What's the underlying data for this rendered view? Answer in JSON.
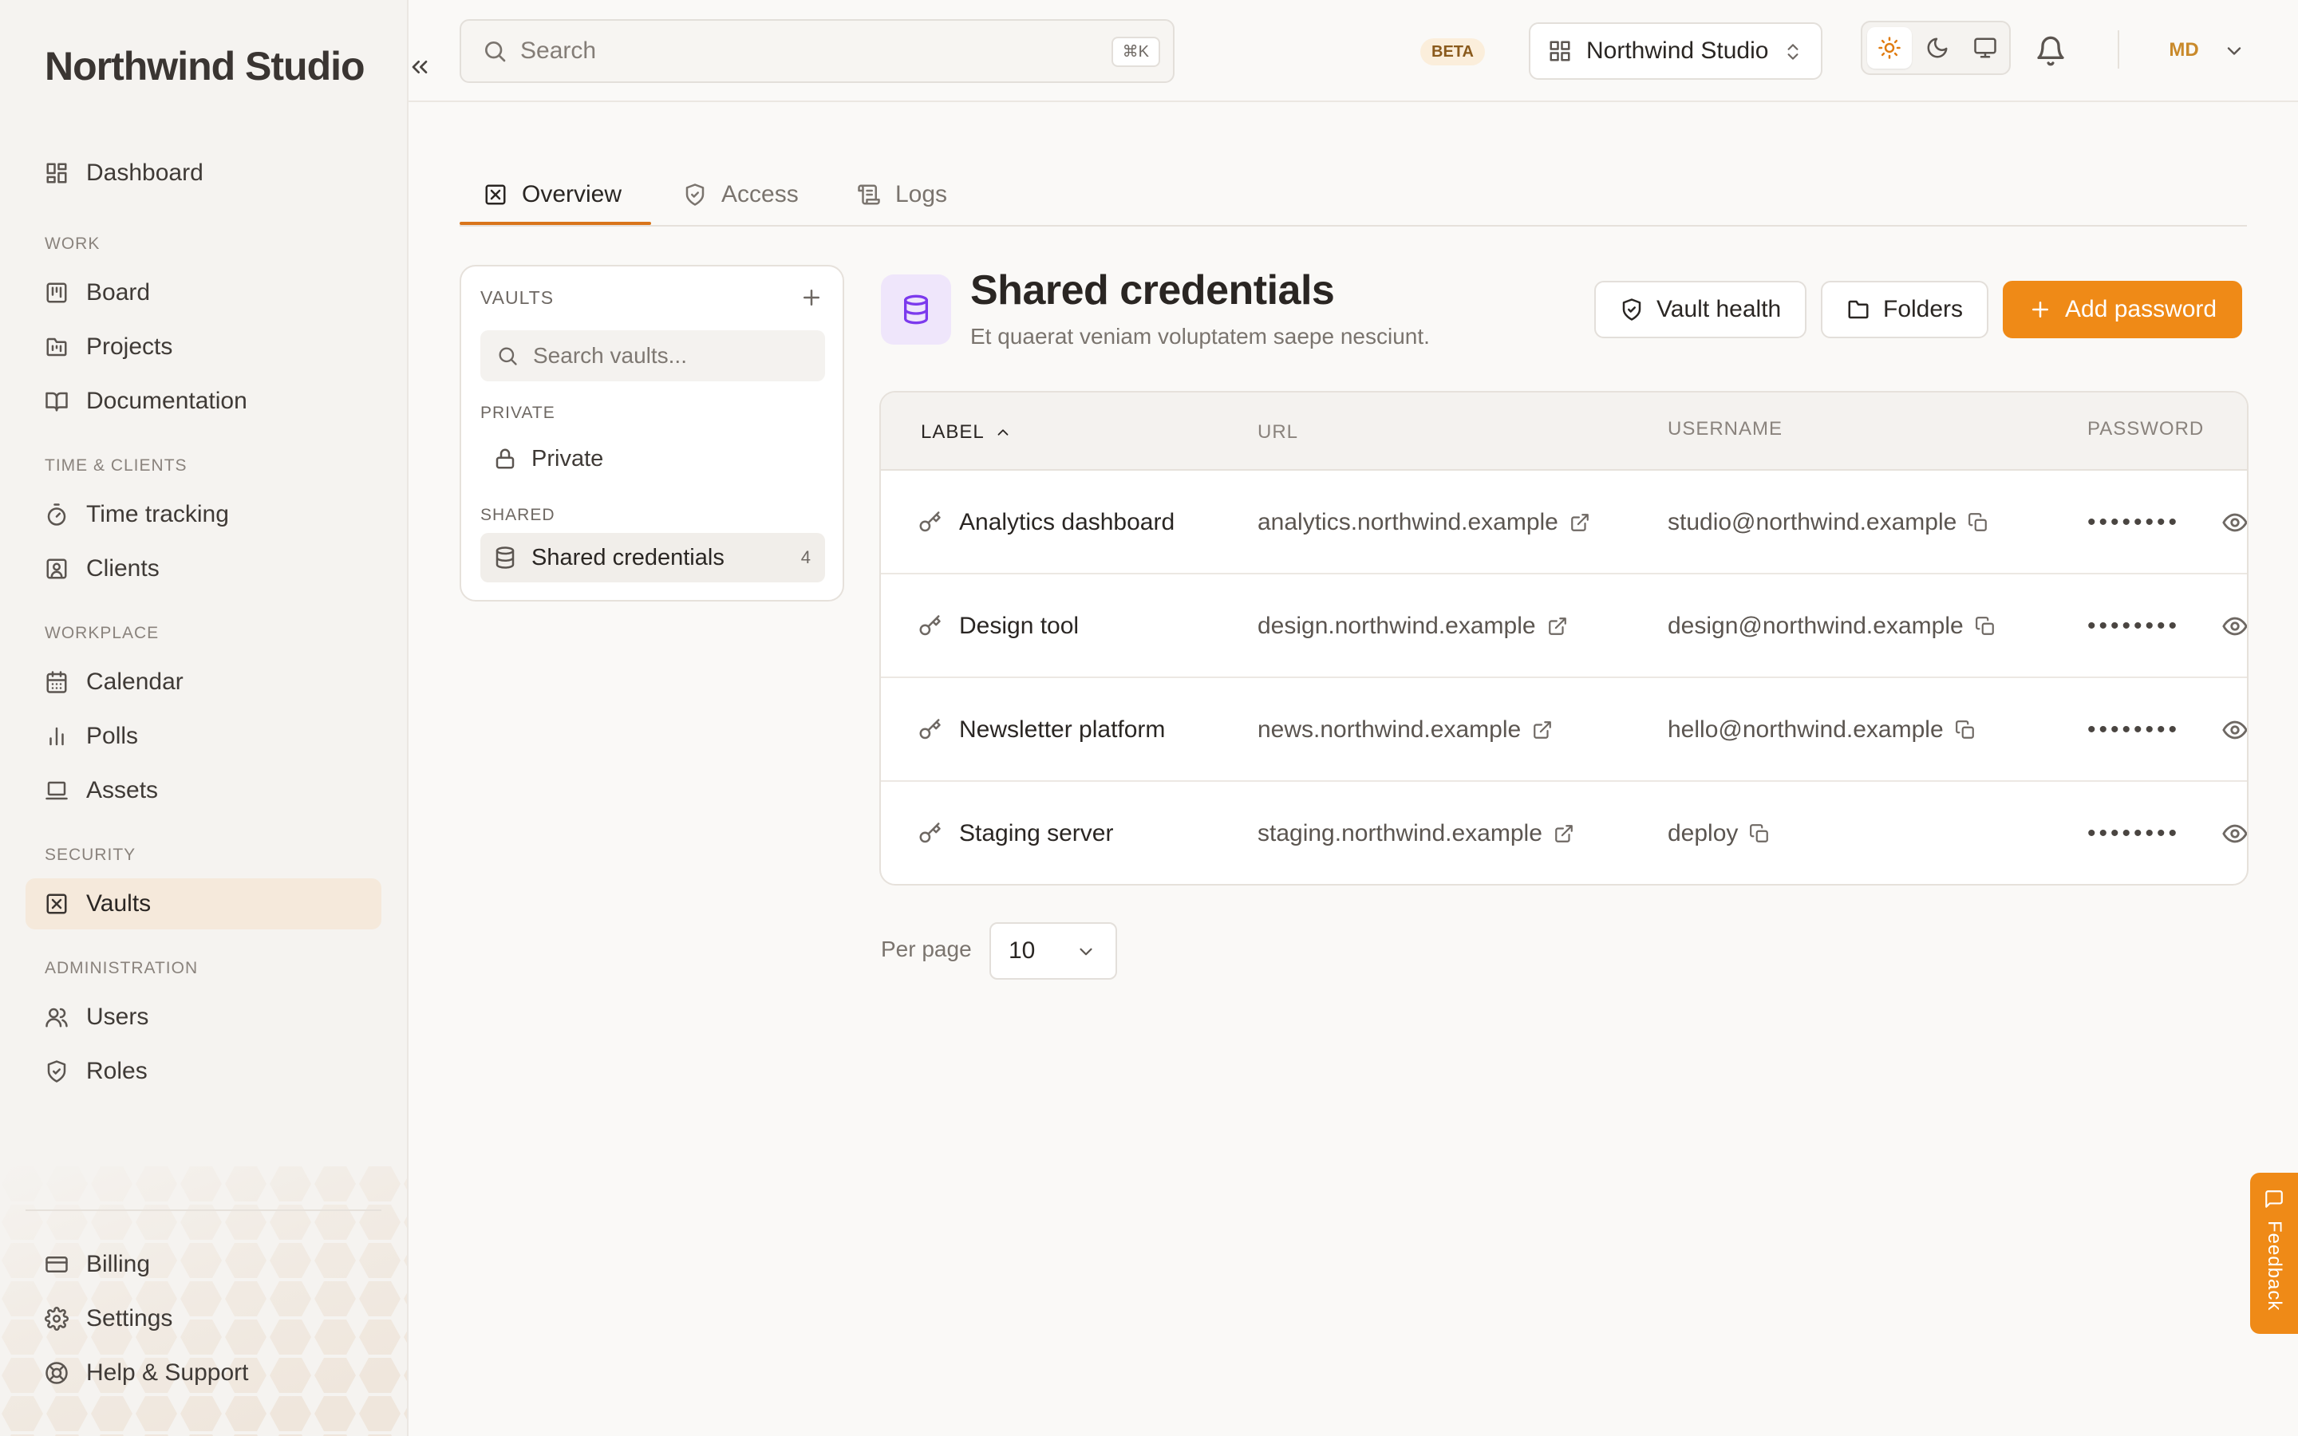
{
  "app": {
    "brand": "Northwind Studio"
  },
  "sidebar": {
    "dashboard": "Dashboard",
    "sections": {
      "work": "WORK",
      "time_clients": "TIME & CLIENTS",
      "workplace": "WORKPLACE",
      "security": "SECURITY",
      "administration": "ADMINISTRATION"
    },
    "items": {
      "board": "Board",
      "projects": "Projects",
      "documentation": "Documentation",
      "time_tracking": "Time tracking",
      "clients": "Clients",
      "calendar": "Calendar",
      "polls": "Polls",
      "assets": "Assets",
      "vaults": "Vaults",
      "users": "Users",
      "roles": "Roles",
      "billing": "Billing",
      "settings": "Settings",
      "help": "Help & Support"
    },
    "active_item": "Vaults"
  },
  "topbar": {
    "search_placeholder": "Search",
    "search_shortcut": "⌘K",
    "beta": "BETA",
    "org_name": "Northwind Studio",
    "theme_selected": "light",
    "avatar_initials": "MD"
  },
  "tabs": {
    "overview": "Overview",
    "access": "Access",
    "logs": "Logs",
    "active": "Overview"
  },
  "vaults_panel": {
    "heading": "VAULTS",
    "search_placeholder": "Search vaults...",
    "private_heading": "PRIVATE",
    "private_item": "Private",
    "shared_heading": "SHARED",
    "shared_item": "Shared credentials",
    "shared_count": "4"
  },
  "header": {
    "title": "Shared credentials",
    "subtitle": "Et quaerat veniam voluptatem saepe nesciunt.",
    "vault_health": "Vault health",
    "folders": "Folders",
    "add_password": "Add password"
  },
  "table": {
    "columns": {
      "label": "LABEL",
      "url": "URL",
      "username": "USERNAME",
      "password": "PASSWORD"
    },
    "rows": [
      {
        "label": "Analytics dashboard",
        "url": "analytics.northwind.example",
        "username": "studio@northwind.example",
        "password": "••••••••"
      },
      {
        "label": "Design tool",
        "url": "design.northwind.example",
        "username": "design@northwind.example",
        "password": "••••••••"
      },
      {
        "label": "Newsletter platform",
        "url": "news.northwind.example",
        "username": "hello@northwind.example",
        "password": "••••••••"
      },
      {
        "label": "Staging server",
        "url": "staging.northwind.example",
        "username": "deploy",
        "password": "••••••••"
      }
    ]
  },
  "pagination": {
    "per_page_label": "Per page",
    "per_page_value": "10"
  },
  "feedback": {
    "label": "Feedback"
  },
  "colors": {
    "accent": "#ef8a17",
    "vault_icon": "#7c3aed",
    "active_nav_bg": "#f5e9db"
  }
}
